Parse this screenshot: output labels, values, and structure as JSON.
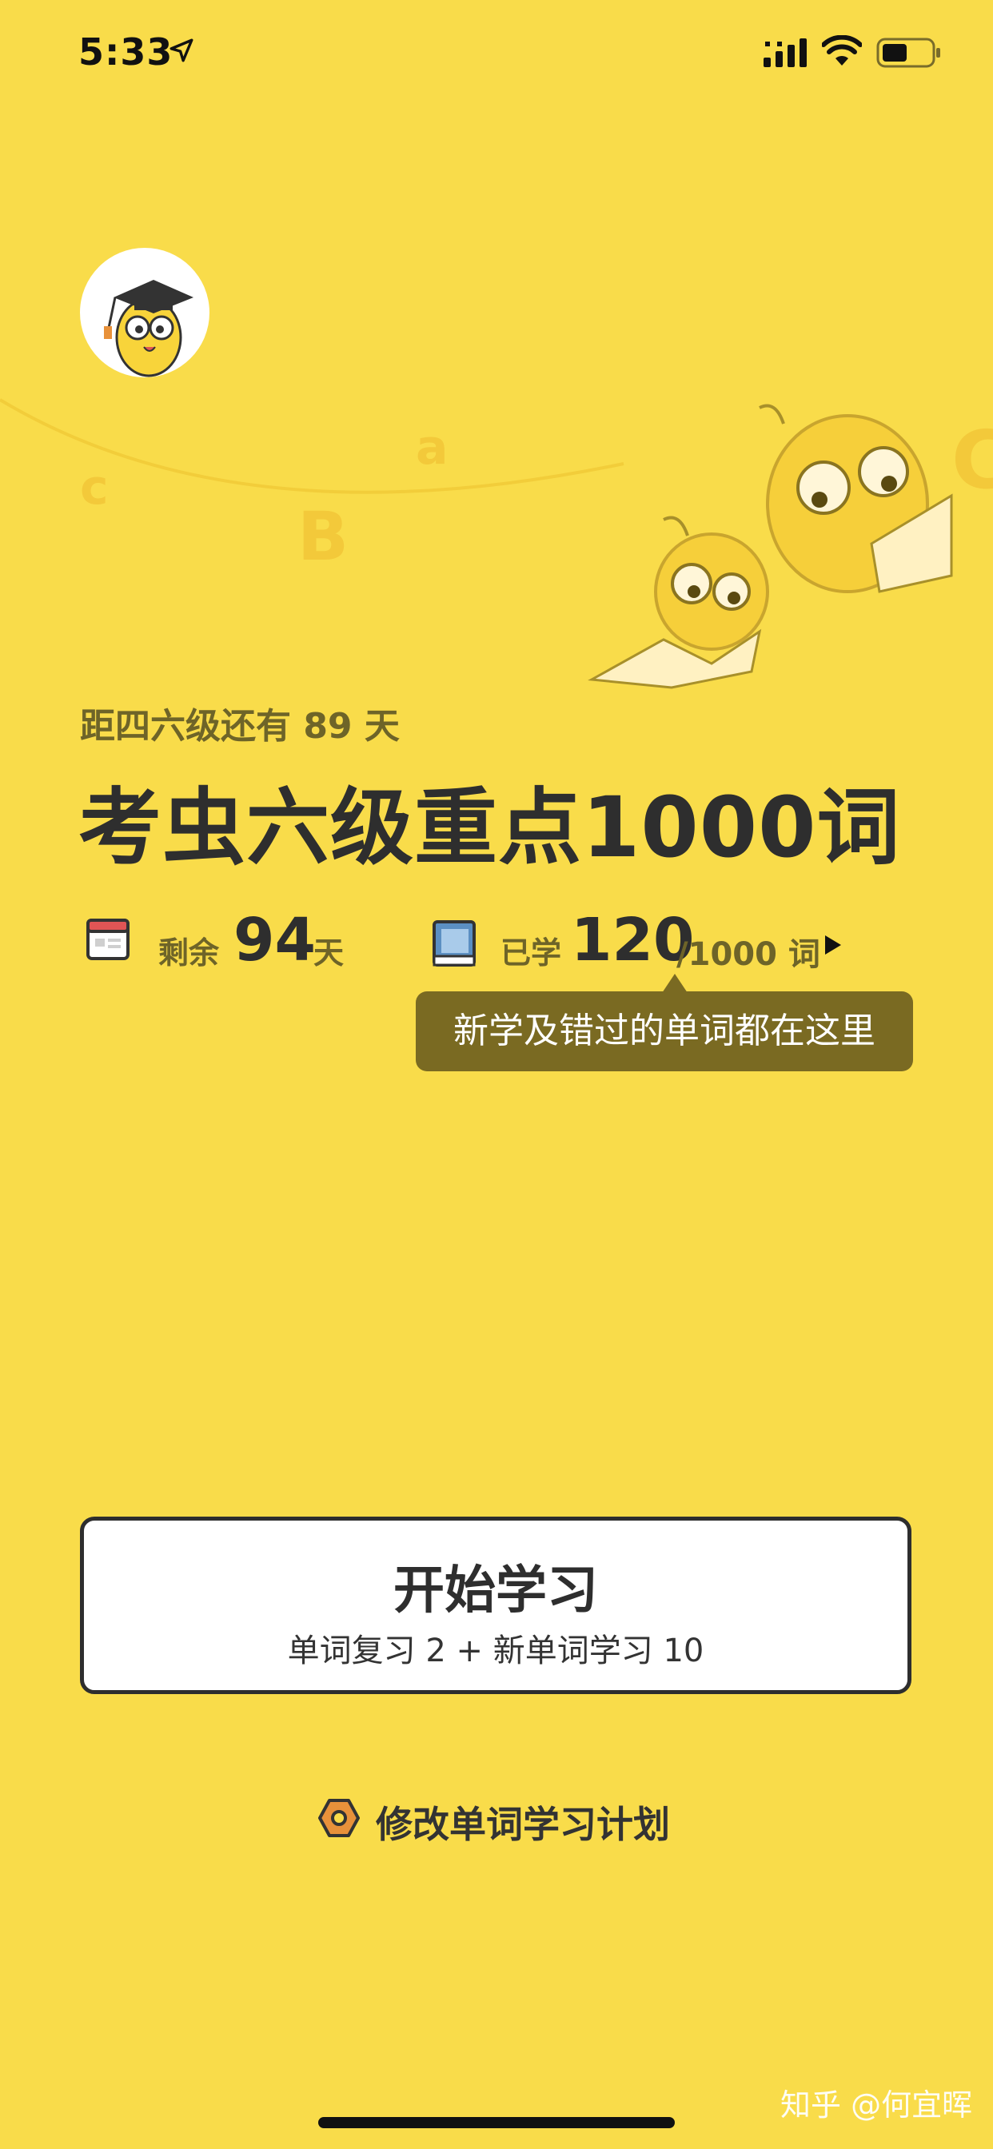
{
  "status_bar": {
    "time": "5:33",
    "icons": [
      "location-arrow-icon",
      "signal-icon",
      "wifi-icon",
      "battery-icon"
    ]
  },
  "header": {
    "countdown": "距四六级还有 89 天",
    "book_title": "考虫六级重点1000词"
  },
  "stats": {
    "remaining_label": "剩余",
    "remaining_value": "94",
    "remaining_unit": "天",
    "learned_label": "已学",
    "learned_value": "120",
    "learned_total": "/1000 词"
  },
  "tooltip": {
    "text": "新学及错过的单词都在这里"
  },
  "start_button": {
    "title": "开始学习",
    "subtitle": "单词复习 2 + 新单词学习 10"
  },
  "plan_link": {
    "label": "修改单词学习计划",
    "icon": "hex-nut-icon"
  },
  "watermark": "知乎 @何宜晖",
  "colors": {
    "background": "#F9DC4A",
    "text_dark": "#2E2E2E",
    "text_muted": "#6E6428",
    "tooltip_bg": "#7A6A22",
    "accent_orange": "#E8913A"
  }
}
